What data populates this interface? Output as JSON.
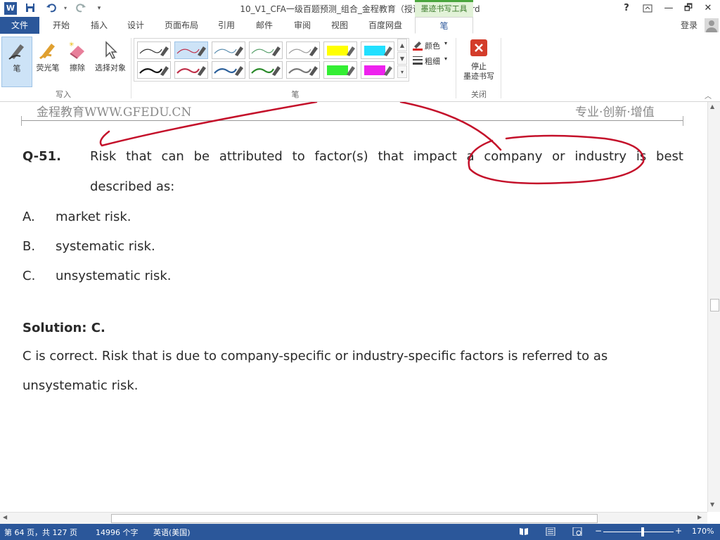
{
  "window": {
    "title": "10_V1_CFA一级百题预测_组合_金程教育（授课版）(1) - Word",
    "context_tab_group": "墨迹书写工具",
    "help": "?",
    "ribbon_display_icon": "ribbon-display-icon",
    "minimize": "—",
    "restore": "🗗",
    "close": "✕"
  },
  "quick_access": {
    "word_icon": "W",
    "save_icon": "save-icon",
    "undo_icon": "undo-icon",
    "redo_icon": "redo-icon",
    "customize_icon": "customize-icon"
  },
  "tabs": [
    {
      "label": "文件"
    },
    {
      "label": "开始"
    },
    {
      "label": "插入"
    },
    {
      "label": "设计"
    },
    {
      "label": "页面布局"
    },
    {
      "label": "引用"
    },
    {
      "label": "邮件"
    },
    {
      "label": "审阅"
    },
    {
      "label": "视图"
    },
    {
      "label": "百度网盘"
    },
    {
      "label": "笔"
    }
  ],
  "account": {
    "login": "登录"
  },
  "ribbon": {
    "write_group": {
      "label": "写入",
      "buttons": [
        {
          "label": "笔",
          "icon": "pen-icon"
        },
        {
          "label": "荧光笔",
          "icon": "highlighter-icon"
        },
        {
          "label": "擦除",
          "icon": "eraser-icon"
        },
        {
          "label": "选择对象",
          "icon": "select-arrow-icon"
        }
      ]
    },
    "pens_group": {
      "label": "笔",
      "color_label": "颜色",
      "thickness_label": "粗细",
      "pen_colors_row1": [
        "#333333",
        "#c0304a",
        "#5d8fb0",
        "#59a06b",
        "#9a9a9a",
        "#ffff00",
        "#22e0ff"
      ],
      "pen_colors_row2": [
        "#111111",
        "#c0304a",
        "#2a5f9a",
        "#2a8a2a",
        "#777777",
        "#33ee33",
        "#ee22ee"
      ]
    },
    "close_group": {
      "label": "关闭",
      "stop_label_line1": "停止",
      "stop_label_line2": "墨迹书写"
    }
  },
  "document": {
    "header_left": "金程教育WWW.GFEDU.CN",
    "header_right": "专业·创新·增值",
    "question_number": "Q-51.",
    "question_line1": "Risk that can be attributed to factor(s) that impact a company or industry is best",
    "question_line2": "described as:",
    "options": [
      {
        "letter": "A.",
        "text": "market risk."
      },
      {
        "letter": "B.",
        "text": "systematic risk."
      },
      {
        "letter": "C.",
        "text": "unsystematic risk."
      }
    ],
    "solution_heading": "Solution: C.",
    "solution_line1": "C is correct. Risk that is due to company-specific or industry-specific factors is referred to as",
    "solution_line2": "unsystematic risk.",
    "ink_color": "#c4102a"
  },
  "status": {
    "page": "第 64 页，共 127 页",
    "words": "14996 个字",
    "language": "英语(美国)",
    "zoom": "170%",
    "zoom_minus": "−",
    "zoom_plus": "+"
  },
  "colors": {
    "accent": "#2b579a",
    "context_tab": "#4aa63d"
  }
}
